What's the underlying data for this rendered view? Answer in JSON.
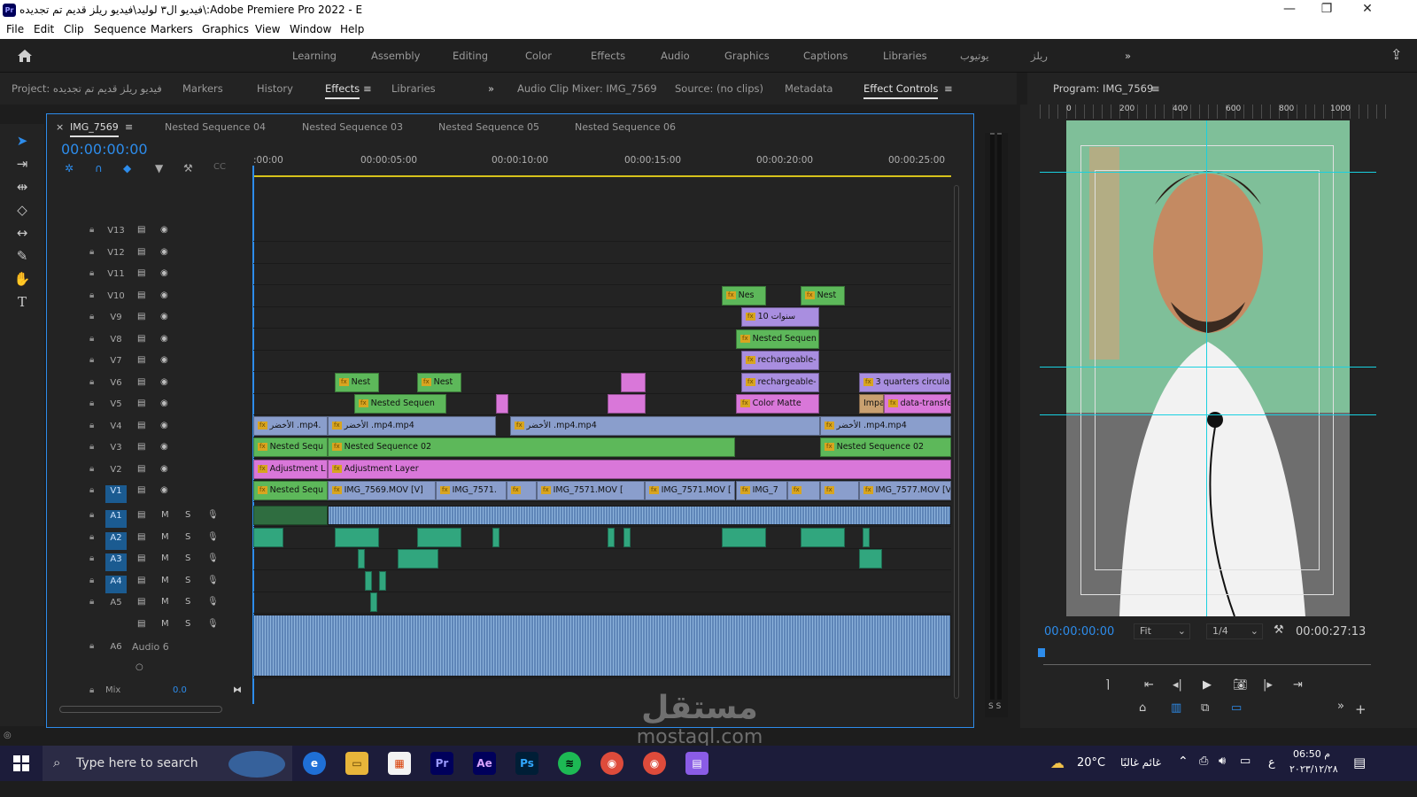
{
  "window": {
    "title": "فيديو ال٣ لوليد\\فيديو ريلز قديم تم تجديده\\:Adobe Premiere Pro 2022 - E",
    "app_badge": "Pr"
  },
  "menu": [
    "File",
    "Edit",
    "Clip",
    "Sequence",
    "Markers",
    "Graphics",
    "View",
    "Window",
    "Help"
  ],
  "workspaces": [
    "Learning",
    "Assembly",
    "Editing",
    "Color",
    "Effects",
    "Audio",
    "Graphics",
    "Captions",
    "Libraries",
    "يوتيوب",
    "ريلز"
  ],
  "panel1_tabs": {
    "project": "Project: فيديو ريلز قديم تم تجديده",
    "markers": "Markers",
    "history": "History",
    "effects": "Effects",
    "libraries": "Libraries"
  },
  "panel2_tabs": {
    "audio_mixer": "Audio Clip Mixer: IMG_7569",
    "source": "Source: (no clips)",
    "metadata": "Metadata",
    "effect_controls": "Effect Controls"
  },
  "program": {
    "title": "Program: IMG_7569",
    "timecode_left": "00:00:00:00",
    "timecode_right": "00:00:27:13",
    "fit": "Fit",
    "quality": "1/4",
    "ruler": [
      "0",
      "200",
      "400",
      "600",
      "800",
      "1000"
    ]
  },
  "timeline": {
    "tabs": [
      "IMG_7569",
      "Nested Sequence 04",
      "Nested Sequence 03",
      "Nested Sequence 05",
      "Nested Sequence 06"
    ],
    "timecode": "00:00:00:00",
    "ruler_labels": [
      ":00:00",
      "00:00:05:00",
      "00:00:10:00",
      "00:00:15:00",
      "00:00:20:00",
      "00:00:25:00"
    ],
    "video_tracks": [
      "V13",
      "V12",
      "V11",
      "V10",
      "V9",
      "V8",
      "V7",
      "V6",
      "V5",
      "V4",
      "V3",
      "V2",
      "V1"
    ],
    "audio_tracks": [
      "A1",
      "A2",
      "A3",
      "A4",
      "A5"
    ],
    "audio6": {
      "name": "Audio 6",
      "id": "A6"
    },
    "mix": {
      "label": "Mix",
      "value": "0.0"
    },
    "ms": [
      "M",
      "S"
    ],
    "clips": {
      "v10a": "Nes",
      "v10b": "Nest",
      "v9": "10 سنوات",
      "v8": "Nested Sequen",
      "v7": "rechargeable-",
      "v6a": "Nest",
      "v6b": "Nest",
      "v6c": "rechargeable-",
      "v6d": "3 quarters circular",
      "v5a": "Nested Sequen",
      "v5b": "Color Matte",
      "v5c": "Impa",
      "v5d": "data-transfe",
      "v4a": "الأخضر .mp4.",
      "v4b": "الأخضر .mp4.mp4",
      "v4c": "الأخضر .mp4.mp4",
      "v4d": "الأخضر .mp4.mp4",
      "v3a": "Nested Sequ",
      "v3b": "Nested Sequence 02",
      "v3c": "Nested Sequence 02",
      "v2a": "Adjustment L",
      "v2b": "Adjustment Layer",
      "v1a": "Nested Sequ",
      "v1b": "IMG_7569.MOV [V]",
      "v1c": "IMG_7571.",
      "v1d": "IMG_7571.MOV [",
      "v1e": "IMG_7571.MOV [",
      "v1f": "IMG_7",
      "v1g": "IMG_7577.MOV [V"
    }
  },
  "taskbar": {
    "search": "Type here to search",
    "weather": "20°C",
    "weather_text": "غائم غالبًا",
    "time": "06:50 م",
    "date": "٢٠٢٣/١٢/٢٨",
    "lang": "ع"
  },
  "watermark": {
    "ar": "مستقل",
    "en": "mostaql.com"
  }
}
